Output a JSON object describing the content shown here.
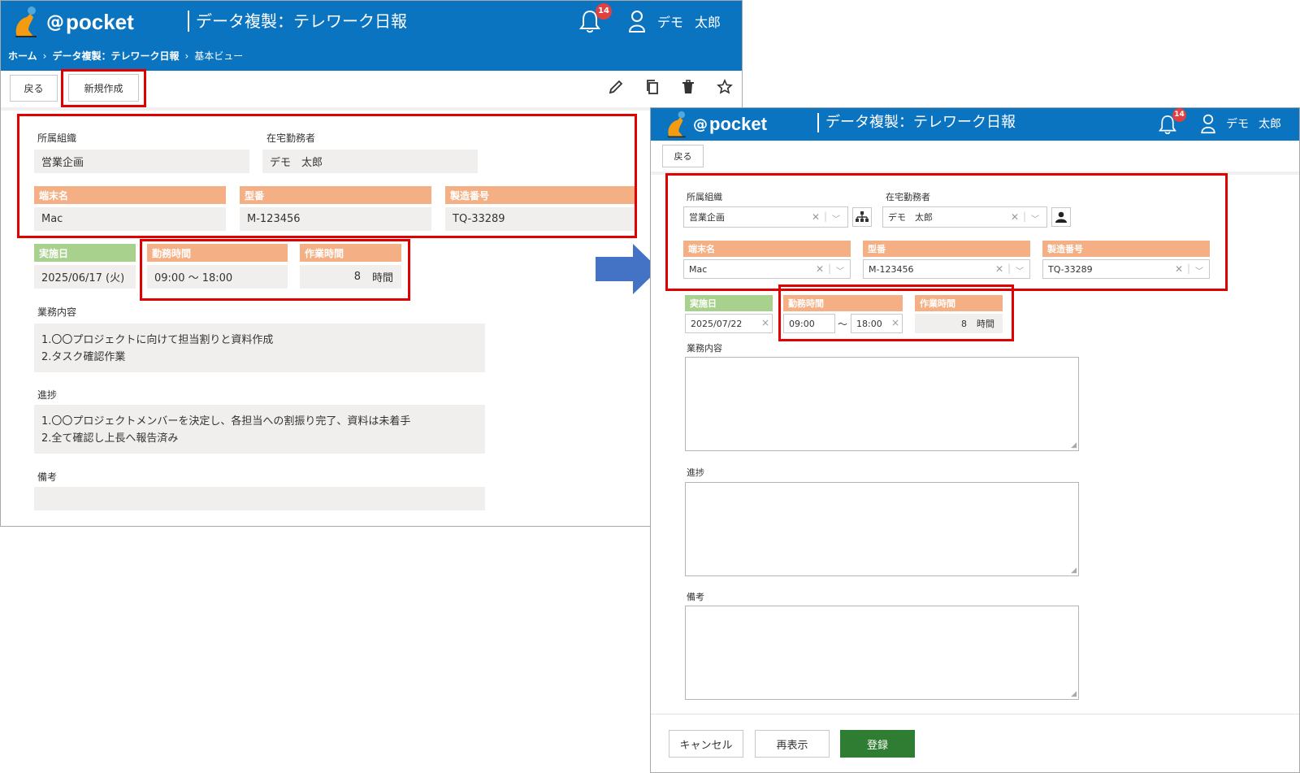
{
  "left": {
    "brand": {
      "at": "@",
      "name": "pocket"
    },
    "title": "データ複製：テレワーク日報",
    "notifications": {
      "count": "14"
    },
    "user": {
      "first": "デモ",
      "last": "太郎"
    },
    "breadcrumb": {
      "home": "ホーム",
      "sep1": "›",
      "page": "データ複製：テレワーク日報",
      "sep2": "›",
      "view": "基本ビュー"
    },
    "toolbar": {
      "back": "戻る",
      "new": "新規作成"
    },
    "org": {
      "label": "所属組織",
      "value": "営業企画"
    },
    "remote_worker": {
      "label": "在宅勤務者",
      "value": "デモ　太郎"
    },
    "terminal": {
      "label": "端末名",
      "value": "Mac"
    },
    "model": {
      "label": "型番",
      "value": "M-123456"
    },
    "serial": {
      "label": "製造番号",
      "value": "TQ-33289"
    },
    "date": {
      "label": "実施日",
      "value": "2025/06/17 (火)"
    },
    "work_time": {
      "label": "勤務時間",
      "value": "09:00 ～ 18:00"
    },
    "work_hours": {
      "label": "作業時間",
      "value": "8",
      "unit": "時間"
    },
    "tasks": {
      "label": "業務内容",
      "line1": "1.〇〇プロジェクトに向けて担当割りと資料作成",
      "line2": "2.タスク確認作業"
    },
    "progress": {
      "label": "進捗",
      "line1": "1.〇〇プロジェクトメンバーを決定し、各担当への割振り完了、資料は未着手",
      "line2": "2.全て確認し上長へ報告済み"
    },
    "notes": {
      "label": "備考",
      "value": ""
    }
  },
  "right": {
    "brand": {
      "at": "@",
      "name": "pocket"
    },
    "title": "データ複製：テレワーク日報",
    "notifications": {
      "count": "14"
    },
    "user": {
      "first": "デモ",
      "last": "太郎"
    },
    "toolbar": {
      "back": "戻る"
    },
    "org": {
      "label": "所属組織",
      "value": "営業企画"
    },
    "remote_worker": {
      "label": "在宅勤務者",
      "value": "デモ　太郎"
    },
    "terminal": {
      "label": "端末名",
      "value": "Mac"
    },
    "model": {
      "label": "型番",
      "value": "M-123456"
    },
    "serial": {
      "label": "製造番号",
      "value": "TQ-33289"
    },
    "date": {
      "label": "実施日",
      "value": "2025/07/22"
    },
    "work_time": {
      "label": "勤務時間",
      "start": "09:00",
      "tilde": "～",
      "end": "18:00"
    },
    "work_hours": {
      "label": "作業時間",
      "value": "8",
      "unit": "時間"
    },
    "tasks": {
      "label": "業務内容"
    },
    "progress": {
      "label": "進捗"
    },
    "notes": {
      "label": "備考"
    },
    "footer": {
      "cancel": "キャンセル",
      "redisplay": "再表示",
      "register": "登録"
    }
  },
  "glyphs": {
    "clear": "✕",
    "clear_small": "×",
    "divider": "|",
    "chevron": "﹀",
    "grip": "◢"
  },
  "colors": {
    "header_blue": "#0a74c1",
    "orange_header": "#f4b084",
    "green_header": "#a9d18e",
    "highlight_red": "#e00000",
    "register_green": "#2e7d32",
    "arrow_blue": "#4472c4",
    "badge_red": "#e04040"
  },
  "icons": {
    "bell": "bell-icon",
    "user": "user-icon",
    "pencil": "pencil-icon",
    "copy": "copy-icon",
    "trash": "trash-icon",
    "star": "star-icon",
    "org_tree": "org-tree-icon",
    "person": "person-icon",
    "arrow": "arrow-right-icon"
  }
}
